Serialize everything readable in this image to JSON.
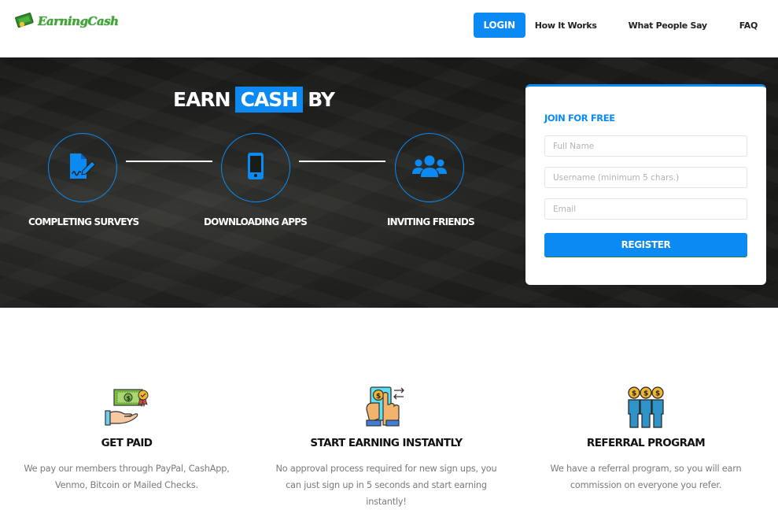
{
  "header": {
    "logo_text": "EarningCash",
    "nav": {
      "login_label": "LOGIN",
      "how_it_works": "How It Works",
      "what_people_say": "What People Say",
      "faq": "FAQ"
    }
  },
  "hero": {
    "title_prefix": "EARN",
    "title_highlight": "CASH",
    "title_suffix": "BY",
    "steps": [
      {
        "label": "COMPLETING SURVEYS",
        "icon": "survey-sign-icon"
      },
      {
        "label": "DOWNLOADING APPS",
        "icon": "mobile-phone-icon"
      },
      {
        "label": "INVITING FRIENDS",
        "icon": "users-group-icon"
      }
    ]
  },
  "register": {
    "title": "JOIN FOR FREE",
    "full_name_placeholder": "Full Name",
    "username_placeholder": "Username (minimum 5 chars.)",
    "email_placeholder": "Email",
    "full_name_value": "",
    "username_value": "",
    "email_value": "",
    "button_label": "REGISTER"
  },
  "features": [
    {
      "title": "GET PAID",
      "description": "We pay our members through PayPal, CashApp, Venmo, Bitcoin or Mailed Checks.",
      "icon": "hand-money-icon"
    },
    {
      "title": "START EARNING INSTANTLY",
      "description": "No approval process required for new sign ups, you can just sign up in 5 seconds and start earning instantly!",
      "icon": "phone-tap-money-icon"
    },
    {
      "title": "REFERRAL PROGRAM",
      "description": "We have a referral program, so you will earn commission on everyone you refer.",
      "icon": "referral-people-icon"
    }
  ],
  "colors": {
    "accent": "#0a8af2",
    "logo_green": "#3fa535"
  }
}
